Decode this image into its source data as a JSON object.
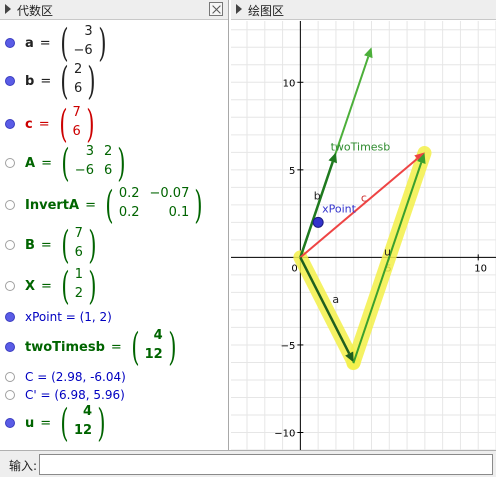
{
  "algebra": {
    "title": "代数区",
    "rows": [
      {
        "name": "a",
        "dot": "on",
        "color": "#222222",
        "matrix": [
          [
            "3"
          ],
          [
            "−6"
          ]
        ]
      },
      {
        "name": "b",
        "dot": "on",
        "color": "#222222",
        "matrix": [
          [
            "2"
          ],
          [
            "6"
          ]
        ]
      },
      {
        "name": "c",
        "dot": "on",
        "color": "#cc0000",
        "matrix": [
          [
            "7"
          ],
          [
            "6"
          ]
        ]
      },
      {
        "name": "A",
        "dot": "off",
        "color": "#006400",
        "matrix": [
          [
            "3",
            "2"
          ],
          [
            "−6",
            "6"
          ]
        ]
      },
      {
        "name": "InvertA",
        "dot": "off",
        "color": "#006400",
        "matrix": [
          [
            "0.2",
            "−0.07"
          ],
          [
            "0.2",
            "0.1"
          ]
        ]
      },
      {
        "name": "B",
        "dot": "off",
        "color": "#006400",
        "matrix": [
          [
            "7"
          ],
          [
            "6"
          ]
        ]
      },
      {
        "name": "X",
        "dot": "off",
        "color": "#006400",
        "matrix": [
          [
            "1"
          ],
          [
            "2"
          ]
        ]
      },
      {
        "text": "xPoint = (1, 2)",
        "dot": "on",
        "color": "#0000c0"
      },
      {
        "name": "twoTimesb",
        "dot": "on",
        "color": "#006400",
        "matrix": [
          [
            "4"
          ],
          [
            "12"
          ]
        ]
      },
      {
        "text": "C = (2.98, -6.04)",
        "dot": "off",
        "color": "#0000c0"
      },
      {
        "text": "C' = (6.98, 5.96)",
        "dot": "off",
        "color": "#0000c0"
      },
      {
        "name": "u",
        "dot": "on",
        "color": "#006400",
        "matrix": [
          [
            "4"
          ],
          [
            "12"
          ]
        ]
      }
    ]
  },
  "graphics": {
    "title": "绘图区",
    "x_ticks": [
      "0",
      "5",
      "10"
    ],
    "y_ticks": [
      "10",
      "5",
      "−5",
      "−10"
    ],
    "x_tick_values": [
      0,
      5,
      10
    ],
    "y_tick_values": [
      10,
      5,
      -5,
      -10
    ],
    "x_range": [
      -3.9,
      11
    ],
    "y_range": [
      -11,
      13.5
    ],
    "vectors": [
      {
        "label": "twoTimesb",
        "from": [
          0,
          0
        ],
        "to": [
          4,
          12
        ],
        "color": "#4caf3a",
        "width": 2
      },
      {
        "label": "b",
        "from": [
          0,
          0
        ],
        "to": [
          2,
          6
        ],
        "color": "#1f7a1f",
        "width": 2.5
      },
      {
        "label": "c",
        "from": [
          0,
          0
        ],
        "to": [
          7,
          6
        ],
        "color": "#ee4444",
        "width": 2
      },
      {
        "label": "a",
        "from": [
          0,
          0
        ],
        "to": [
          3,
          -6
        ],
        "color": "#1f5f1f",
        "width": 2.5,
        "highlight": true
      },
      {
        "label": "u",
        "from": [
          2.98,
          -6.04
        ],
        "to": [
          6.98,
          5.96
        ],
        "color": "#3aa02e",
        "width": 2,
        "highlight": true
      }
    ],
    "points": [
      {
        "label": "xPoint",
        "x": 1,
        "y": 2,
        "color": "#3333cc"
      }
    ],
    "colors": {
      "highlight": "#f4f04a",
      "grid": "#e6e6e6",
      "axis": "#000000"
    }
  },
  "input": {
    "label": "输入:",
    "value": ""
  }
}
